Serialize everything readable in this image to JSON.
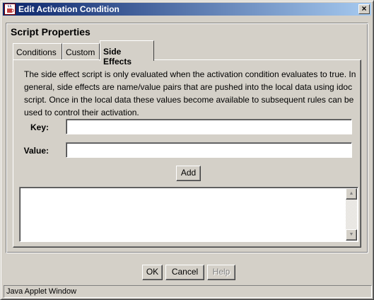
{
  "window": {
    "title": "Edit Activation Condition",
    "close_glyph": "×",
    "icon": "java-cup-icon"
  },
  "group": {
    "title": "Script Properties"
  },
  "tabs": [
    {
      "label": "Conditions",
      "active": false
    },
    {
      "label": "Custom",
      "active": false
    },
    {
      "label": "Side Effects",
      "active": true
    }
  ],
  "side_effects": {
    "description": "The side effect script is only evaluated when the activation condition evaluates to true. In general, side effects are name/value pairs that are pushed into the local data using idoc script. Once in the local data these values become available to subsequent rules can be used to control their activation.",
    "key_label": "Key:",
    "key_value": "",
    "value_label": "Value:",
    "value_value": "",
    "add_label": "Add",
    "script_text": ""
  },
  "footer": {
    "ok_label": "OK",
    "cancel_label": "Cancel",
    "help_label": "Help",
    "help_enabled": false
  },
  "status": {
    "text": "Java Applet Window"
  },
  "colors": {
    "title_gradient_start": "#0a246a",
    "title_gradient_end": "#a6caf0",
    "face": "#d4d0c8"
  }
}
